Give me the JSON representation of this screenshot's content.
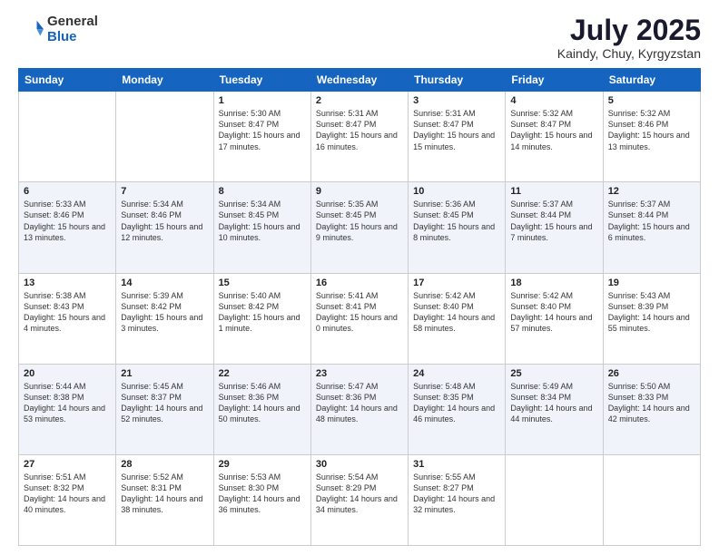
{
  "logo": {
    "general": "General",
    "blue": "Blue"
  },
  "header": {
    "month": "July 2025",
    "location": "Kaindy, Chuy, Kyrgyzstan"
  },
  "weekdays": [
    "Sunday",
    "Monday",
    "Tuesday",
    "Wednesday",
    "Thursday",
    "Friday",
    "Saturday"
  ],
  "weeks": [
    [
      {
        "day": "",
        "info": ""
      },
      {
        "day": "",
        "info": ""
      },
      {
        "day": "1",
        "info": "Sunrise: 5:30 AM\nSunset: 8:47 PM\nDaylight: 15 hours and 17 minutes."
      },
      {
        "day": "2",
        "info": "Sunrise: 5:31 AM\nSunset: 8:47 PM\nDaylight: 15 hours and 16 minutes."
      },
      {
        "day": "3",
        "info": "Sunrise: 5:31 AM\nSunset: 8:47 PM\nDaylight: 15 hours and 15 minutes."
      },
      {
        "day": "4",
        "info": "Sunrise: 5:32 AM\nSunset: 8:47 PM\nDaylight: 15 hours and 14 minutes."
      },
      {
        "day": "5",
        "info": "Sunrise: 5:32 AM\nSunset: 8:46 PM\nDaylight: 15 hours and 13 minutes."
      }
    ],
    [
      {
        "day": "6",
        "info": "Sunrise: 5:33 AM\nSunset: 8:46 PM\nDaylight: 15 hours and 13 minutes."
      },
      {
        "day": "7",
        "info": "Sunrise: 5:34 AM\nSunset: 8:46 PM\nDaylight: 15 hours and 12 minutes."
      },
      {
        "day": "8",
        "info": "Sunrise: 5:34 AM\nSunset: 8:45 PM\nDaylight: 15 hours and 10 minutes."
      },
      {
        "day": "9",
        "info": "Sunrise: 5:35 AM\nSunset: 8:45 PM\nDaylight: 15 hours and 9 minutes."
      },
      {
        "day": "10",
        "info": "Sunrise: 5:36 AM\nSunset: 8:45 PM\nDaylight: 15 hours and 8 minutes."
      },
      {
        "day": "11",
        "info": "Sunrise: 5:37 AM\nSunset: 8:44 PM\nDaylight: 15 hours and 7 minutes."
      },
      {
        "day": "12",
        "info": "Sunrise: 5:37 AM\nSunset: 8:44 PM\nDaylight: 15 hours and 6 minutes."
      }
    ],
    [
      {
        "day": "13",
        "info": "Sunrise: 5:38 AM\nSunset: 8:43 PM\nDaylight: 15 hours and 4 minutes."
      },
      {
        "day": "14",
        "info": "Sunrise: 5:39 AM\nSunset: 8:42 PM\nDaylight: 15 hours and 3 minutes."
      },
      {
        "day": "15",
        "info": "Sunrise: 5:40 AM\nSunset: 8:42 PM\nDaylight: 15 hours and 1 minute."
      },
      {
        "day": "16",
        "info": "Sunrise: 5:41 AM\nSunset: 8:41 PM\nDaylight: 15 hours and 0 minutes."
      },
      {
        "day": "17",
        "info": "Sunrise: 5:42 AM\nSunset: 8:40 PM\nDaylight: 14 hours and 58 minutes."
      },
      {
        "day": "18",
        "info": "Sunrise: 5:42 AM\nSunset: 8:40 PM\nDaylight: 14 hours and 57 minutes."
      },
      {
        "day": "19",
        "info": "Sunrise: 5:43 AM\nSunset: 8:39 PM\nDaylight: 14 hours and 55 minutes."
      }
    ],
    [
      {
        "day": "20",
        "info": "Sunrise: 5:44 AM\nSunset: 8:38 PM\nDaylight: 14 hours and 53 minutes."
      },
      {
        "day": "21",
        "info": "Sunrise: 5:45 AM\nSunset: 8:37 PM\nDaylight: 14 hours and 52 minutes."
      },
      {
        "day": "22",
        "info": "Sunrise: 5:46 AM\nSunset: 8:36 PM\nDaylight: 14 hours and 50 minutes."
      },
      {
        "day": "23",
        "info": "Sunrise: 5:47 AM\nSunset: 8:36 PM\nDaylight: 14 hours and 48 minutes."
      },
      {
        "day": "24",
        "info": "Sunrise: 5:48 AM\nSunset: 8:35 PM\nDaylight: 14 hours and 46 minutes."
      },
      {
        "day": "25",
        "info": "Sunrise: 5:49 AM\nSunset: 8:34 PM\nDaylight: 14 hours and 44 minutes."
      },
      {
        "day": "26",
        "info": "Sunrise: 5:50 AM\nSunset: 8:33 PM\nDaylight: 14 hours and 42 minutes."
      }
    ],
    [
      {
        "day": "27",
        "info": "Sunrise: 5:51 AM\nSunset: 8:32 PM\nDaylight: 14 hours and 40 minutes."
      },
      {
        "day": "28",
        "info": "Sunrise: 5:52 AM\nSunset: 8:31 PM\nDaylight: 14 hours and 38 minutes."
      },
      {
        "day": "29",
        "info": "Sunrise: 5:53 AM\nSunset: 8:30 PM\nDaylight: 14 hours and 36 minutes."
      },
      {
        "day": "30",
        "info": "Sunrise: 5:54 AM\nSunset: 8:29 PM\nDaylight: 14 hours and 34 minutes."
      },
      {
        "day": "31",
        "info": "Sunrise: 5:55 AM\nSunset: 8:27 PM\nDaylight: 14 hours and 32 minutes."
      },
      {
        "day": "",
        "info": ""
      },
      {
        "day": "",
        "info": ""
      }
    ]
  ]
}
